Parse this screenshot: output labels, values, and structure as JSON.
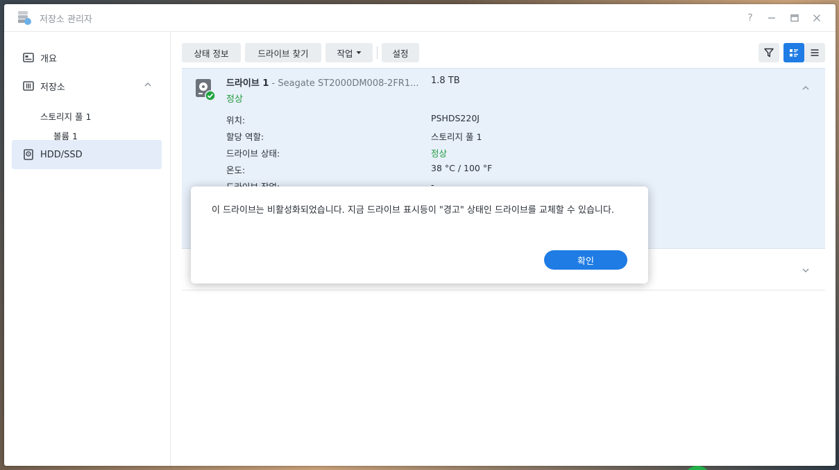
{
  "window": {
    "title": "저장소 관리자",
    "controls": {
      "help": "?",
      "minimize": "—",
      "maximize": "□",
      "close": "✕"
    }
  },
  "sidebar": {
    "items": [
      {
        "label": "개요",
        "icon": "overview-icon"
      },
      {
        "label": "저장소",
        "icon": "storage-icon"
      },
      {
        "label": "스토리지 풀 1"
      },
      {
        "label": "볼륨 1"
      },
      {
        "label": "HDD/SSD",
        "icon": "hdd-icon",
        "active": true
      }
    ]
  },
  "toolbar": {
    "status_info": "상태 정보",
    "find_drive": "드라이브 찾기",
    "action": "작업",
    "settings": "설정"
  },
  "drive": {
    "name": "드라이브 1",
    "model": " - Seagate ST2000DM008-2FR1...",
    "size": "1.8 TB",
    "status": "정상",
    "properties": [
      {
        "label": "위치:",
        "value": "PSHDS220J"
      },
      {
        "label": "할당 역할:",
        "value": "스토리지 풀 1"
      },
      {
        "label": "드라이브 상태:",
        "value": "정상"
      },
      {
        "label": "온도:",
        "value": "38 °C / 100 °F"
      },
      {
        "label": "드라이브 작업:",
        "value": "-"
      }
    ]
  },
  "dialog": {
    "message": "이 드라이브는 비활성화되었습니다. 지금 드라이브 표시등이 \"경고\" 상태인 드라이브를 교체할 수 있습니다.",
    "ok_label": "확인"
  },
  "colors": {
    "accent": "#1f7ce4",
    "status_ok": "#1f9a3a",
    "selected_row": "#e8f0fa"
  }
}
